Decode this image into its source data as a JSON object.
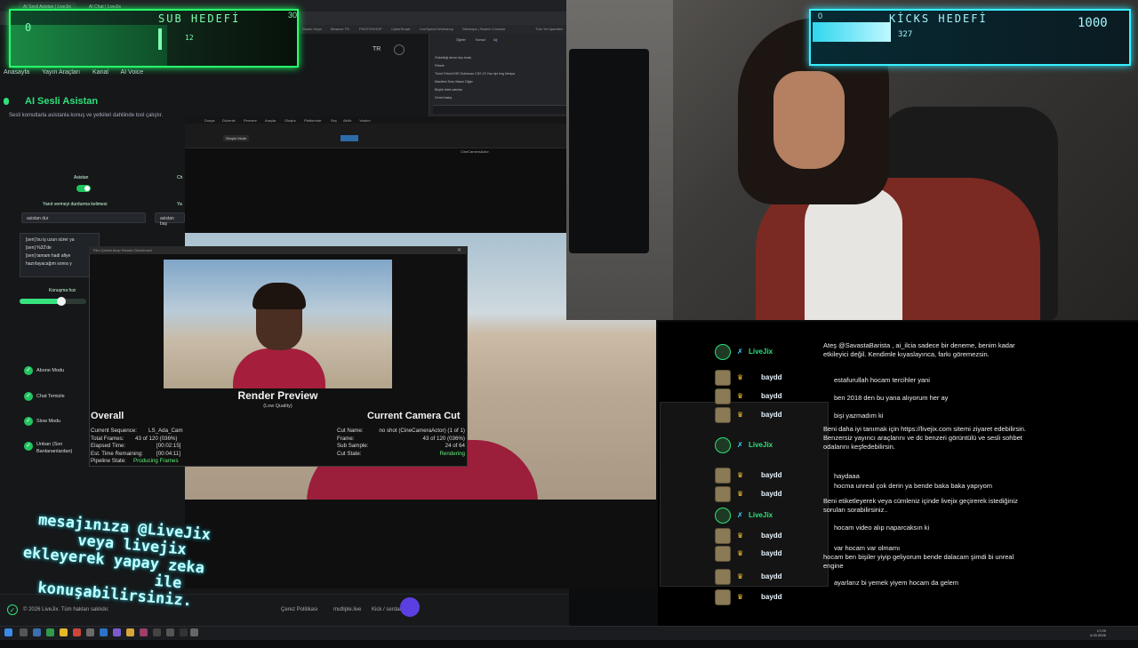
{
  "browser": {
    "tabs": [
      "AI Sesli Asistan | LiveJix",
      "AI Chat | LiveJix"
    ],
    "bookmarks": [
      "Studio Heyn",
      "Binance TR",
      "PHOTOSHOP",
      "CyberSmart",
      "LiveSpeed Workshop",
      "Sitemaps | Search Console",
      "Tüm Yer İşaretleri"
    ],
    "lang": "TR"
  },
  "site": {
    "nav": [
      "Anasayfa",
      "Yayın Araçları",
      "Kanal",
      "AI Voice"
    ],
    "title": "AI Sesli Asistan",
    "subtitle": "Sesli komutlarla asistanla konuş ve yetkileri dahilinde tool çalıştır.",
    "asistan_label": "Asistan",
    "ch_label": "Ch",
    "stop_label": "Yanıt vermeyi durdurma kelimesi",
    "ya_label": "Ya",
    "stop_value": "asistan dur",
    "start_value": "asistan baş",
    "log": [
      "[sen] bu iş uzun sürer ya",
      "[sen] %32'de",
      "[sen] tamam hadi afiye",
      "hazırlayacağım sonra y"
    ],
    "speed_label": "Konuşma hızı",
    "speed_fraction": 0.63,
    "features": [
      "Abone Modu",
      "Chat Temizle",
      "Slow Modu",
      "Unban (Son Banlananlardan)"
    ],
    "footer_copyright": "© 2026 LiveJix. Tüm hakları saklıdır.",
    "footer_links": [
      "Çerez Politikası",
      "mutliple.live",
      "Kick / serdar"
    ]
  },
  "sub_goal": {
    "title": "SUB HEDEFİ",
    "left": "0",
    "right": "30",
    "current": "12",
    "accent": "#29ff6b"
  },
  "devtools": {
    "tabs": [
      "Öğeler",
      "Konsol",
      "Ağ"
    ],
    "rows": [
      "Önbelleği devre dışı bırak",
      "Filtrele",
      "Tümü  Fetch/XHR  Doküman  CSS  JS  Yazı tipi  Img  Medya",
      "Manifest  Soru  Wasm  Diğer",
      "Büyük istek satırları",
      "Genel bakış"
    ]
  },
  "unreal": {
    "menu": [
      "Dosya",
      "Düzenle",
      "Pencere",
      "Araçlar",
      "Oluştur",
      "Platformlar",
      "Seç",
      "Aktör",
      "Yardım"
    ],
    "mode": "Simple Mode",
    "cam": "CineCameraActor",
    "level": "Rendering",
    "window_title": "Film Çekimi Akışı Render Önizlemesi"
  },
  "render": {
    "heading": "Render Preview",
    "quality": "(Low Quality)",
    "overall_title": "Overall",
    "cut_title": "Current Camera Cut",
    "overall": [
      {
        "k": "Current Sequence:",
        "v": "LS_Ada_Cam"
      },
      {
        "k": "Total Frames:",
        "v": "43 of 120 (036%)"
      },
      {
        "k": "Elapsed Time:",
        "v": "[00:02:15]"
      },
      {
        "k": "Est. Time Remaining:",
        "v": "[00:04:11]"
      },
      {
        "k": "Pipeline State:",
        "v": "Producing Frames"
      }
    ],
    "cut": [
      {
        "k": "Cut Name:",
        "v": "no shot (CineCameraActor) (1 of 1)"
      },
      {
        "k": "Frame:",
        "v": "43 of 120 (036%)"
      },
      {
        "k": "Sub Sample:",
        "v": "24 of 64"
      },
      {
        "k": "Cut State:",
        "v": "Rendering"
      }
    ]
  },
  "kicks_goal": {
    "title": "KİCKS HEDEFİ",
    "left": "0",
    "right": "1000",
    "current": "327",
    "fraction": 0.327,
    "accent": "#37f0ff"
  },
  "chat": {
    "users": [
      {
        "name": "LiveJix",
        "kind": "bot"
      },
      {
        "name": "baydd",
        "kind": "user"
      },
      {
        "name": "baydd",
        "kind": "user"
      },
      {
        "name": "baydd",
        "kind": "user"
      },
      {
        "name": "LiveJix",
        "kind": "bot"
      },
      {
        "name": "baydd",
        "kind": "user"
      },
      {
        "name": "baydd",
        "kind": "user"
      },
      {
        "name": "LiveJix",
        "kind": "bot"
      },
      {
        "name": "baydd",
        "kind": "user"
      },
      {
        "name": "baydd",
        "kind": "user"
      },
      {
        "name": "baydd",
        "kind": "user"
      },
      {
        "name": "baydd",
        "kind": "user"
      }
    ],
    "messages": [
      "Ateş @SavastaBarista , ai_ilcia sadece bir deneme, benim kadar etkileyici değil. Kendimle kıyaslayınca, farkı göremezsin.",
      "estafurullah hocam tercihler yani",
      "ben 2018 den bu yana alıyorum her ay",
      "bişi yazmadım ki",
      "Beni daha iyi tanımak için https://livejix.com sitemi ziyaret edebilirsin. Benzersiz yayıncı araçlarını ve dc benzeri görüntülü ve sesli sohbet odalarını keşfedebilirsin.",
      "haydaaa",
      "hocma unreal çok derin ya bende baka baka yapıyom",
      "Beni etiketleyerek veya cümleniz içinde livejix geçirerek istediğiniz soruları sorabilirsiniz..",
      "hocam video alıp naparcaksın ki",
      "var hocam var olmamı",
      "hocam ben bişiler yiyip geliyorum bende dalacam şimdi bi unreal engine",
      "ayarlarız bi yemek yiyem hocam da gelem"
    ]
  },
  "promo": [
    "mesajınıza @LiveJix",
    "veya livejix",
    "ekleyerek yapay zeka",
    "ile",
    "konuşabilirsiniz."
  ],
  "taskbar": {
    "time": "17:09",
    "date": "4.03.2026"
  }
}
